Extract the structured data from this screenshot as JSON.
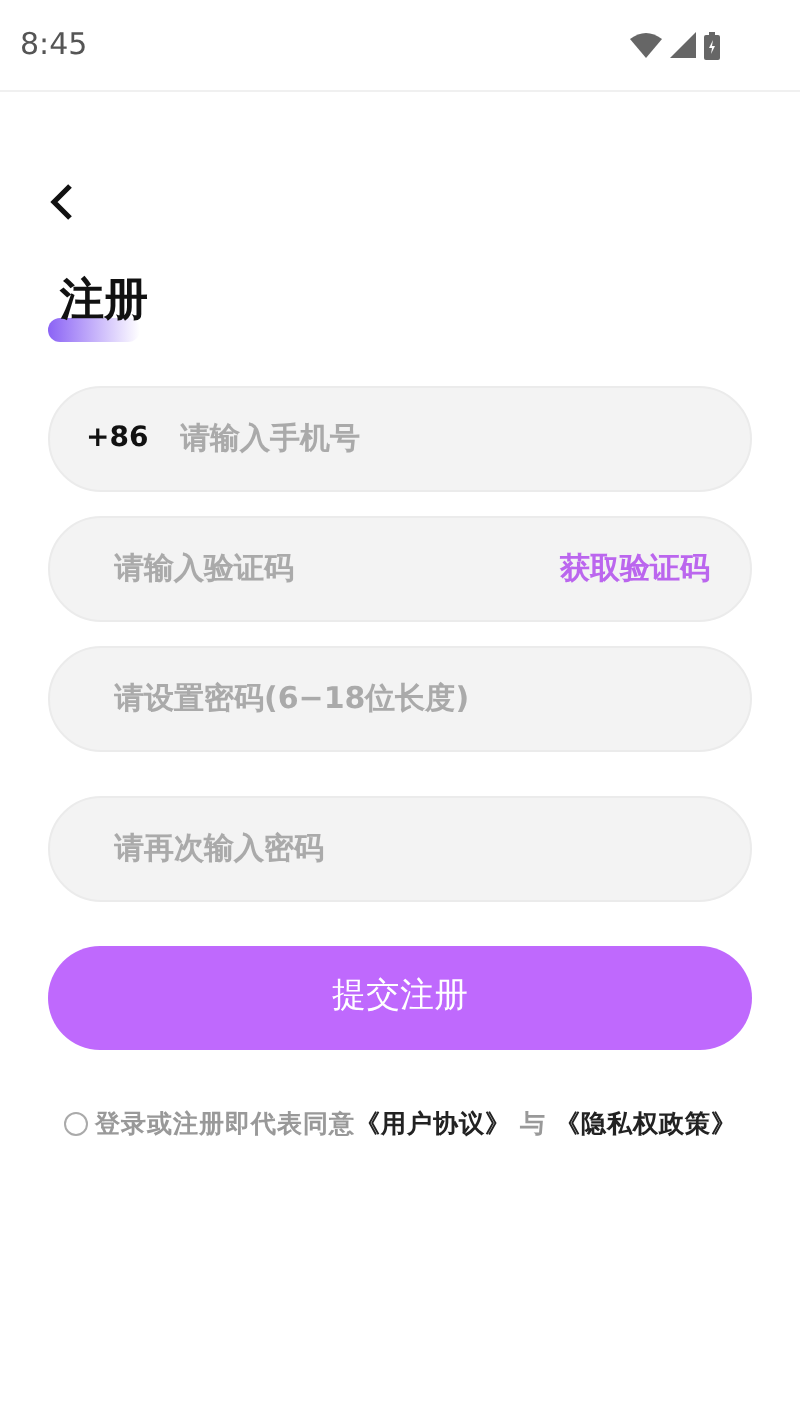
{
  "status_bar": {
    "time": "8:45"
  },
  "title": "注册",
  "fields": [
    {
      "kind": "phone",
      "prefix": "+86",
      "placeholder": "请输入手机号"
    },
    {
      "kind": "code",
      "placeholder": "请输入验证码",
      "action": "获取验证码"
    },
    {
      "kind": "plain",
      "placeholder": "请设置密码(6−18位长度)"
    },
    {
      "kind": "plain",
      "placeholder": "请再次输入密码"
    }
  ],
  "submit": "提交注册",
  "agreement": {
    "checked": false,
    "text": "登录或注册即代表同意",
    "link_1": "《用户协议》",
    "joiner": "与",
    "link_2": "《隐私权政策》"
  }
}
